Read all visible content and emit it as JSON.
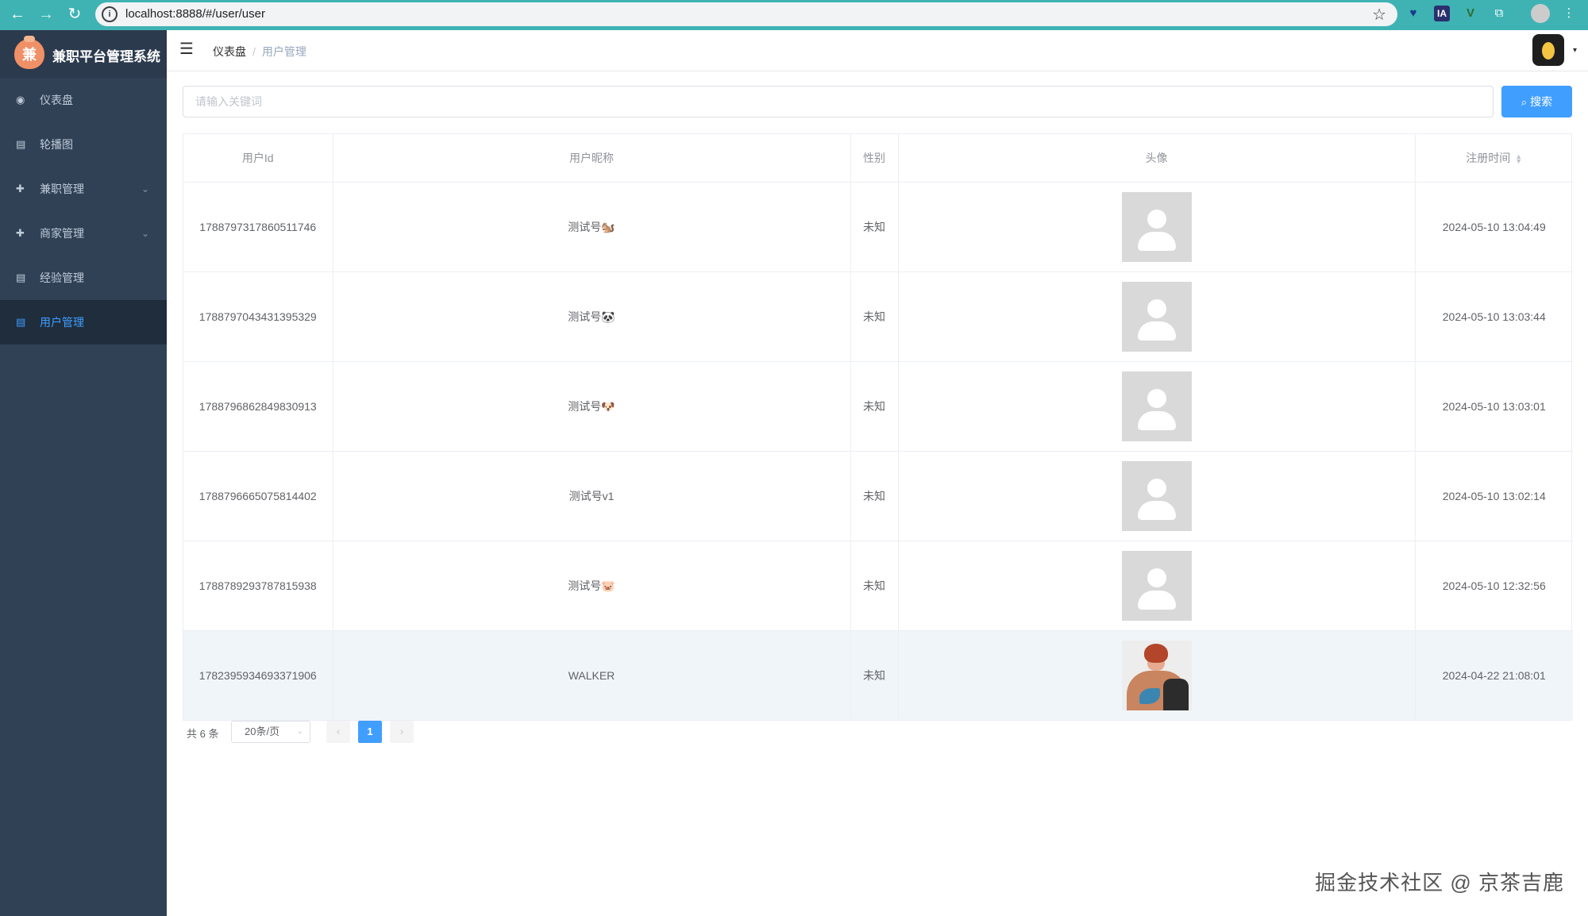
{
  "browser": {
    "url": "localhost:8888/#/user/user",
    "back": "←",
    "forward": "→",
    "reload": "↻",
    "star": "☆",
    "ext_ia": "IA",
    "ext_v": "V",
    "ext_puzzle": "⧉",
    "menu": "⋮",
    "ext_pin": "♥"
  },
  "sidebar": {
    "brand_title": "兼职平台管理系统",
    "brand_logo_text": "兼",
    "items": [
      {
        "label": "仪表盘",
        "icon": "dashboard-icon",
        "glyph": "◉"
      },
      {
        "label": "轮播图",
        "icon": "document-icon",
        "glyph": "▤"
      },
      {
        "label": "兼职管理",
        "icon": "plus-circle-icon",
        "glyph": "✚",
        "arrow": "⌄"
      },
      {
        "label": "商家管理",
        "icon": "plus-circle-icon",
        "glyph": "✚",
        "arrow": "⌄"
      },
      {
        "label": "经验管理",
        "icon": "document-icon",
        "glyph": "▤"
      },
      {
        "label": "用户管理",
        "icon": "document-icon",
        "glyph": "▤",
        "active": true
      }
    ]
  },
  "navbar": {
    "hamburger": "☰",
    "breadcrumb_home": "仪表盘",
    "breadcrumb_sep": "/",
    "breadcrumb_current": "用户管理",
    "avatar_caret": "▾"
  },
  "search": {
    "placeholder": "请输入关键词",
    "button_icon": "⌕",
    "button_label": "搜索"
  },
  "table": {
    "headers": [
      "用户Id",
      "用户昵称",
      "性别",
      "头像",
      "注册时间"
    ],
    "sort_caret_up": "▲",
    "sort_caret_down": "▼",
    "rows": [
      {
        "id": "1788797317860511746",
        "nickname": "测试号🐿️",
        "gender": "未知",
        "avatar": "placeholder",
        "time": "2024-05-10 13:04:49"
      },
      {
        "id": "1788797043431395329",
        "nickname": "测试号🐼",
        "gender": "未知",
        "avatar": "placeholder",
        "time": "2024-05-10 13:03:44"
      },
      {
        "id": "1788796862849830913",
        "nickname": "测试号🐶",
        "gender": "未知",
        "avatar": "placeholder",
        "time": "2024-05-10 13:03:01"
      },
      {
        "id": "1788796665075814402",
        "nickname": "测试号v1",
        "gender": "未知",
        "avatar": "placeholder",
        "time": "2024-05-10 13:02:14"
      },
      {
        "id": "1788789293787815938",
        "nickname": "测试号🐷",
        "gender": "未知",
        "avatar": "placeholder",
        "time": "2024-05-10 12:32:56"
      },
      {
        "id": "1782395934693371906",
        "nickname": "WALKER",
        "gender": "未知",
        "avatar": "photo",
        "time": "2024-04-22 21:08:01"
      }
    ]
  },
  "pagination": {
    "total": "共 6 条",
    "page_size": "20条/页",
    "page_size_caret": "⌄",
    "prev": "‹",
    "next": "›",
    "current_page": "1"
  },
  "watermark": "掘金技术社区 @ 京茶吉鹿",
  "colors": {
    "primary": "#409eff",
    "sidebar_bg": "#304156",
    "browser_bar": "#3fb3b4"
  }
}
